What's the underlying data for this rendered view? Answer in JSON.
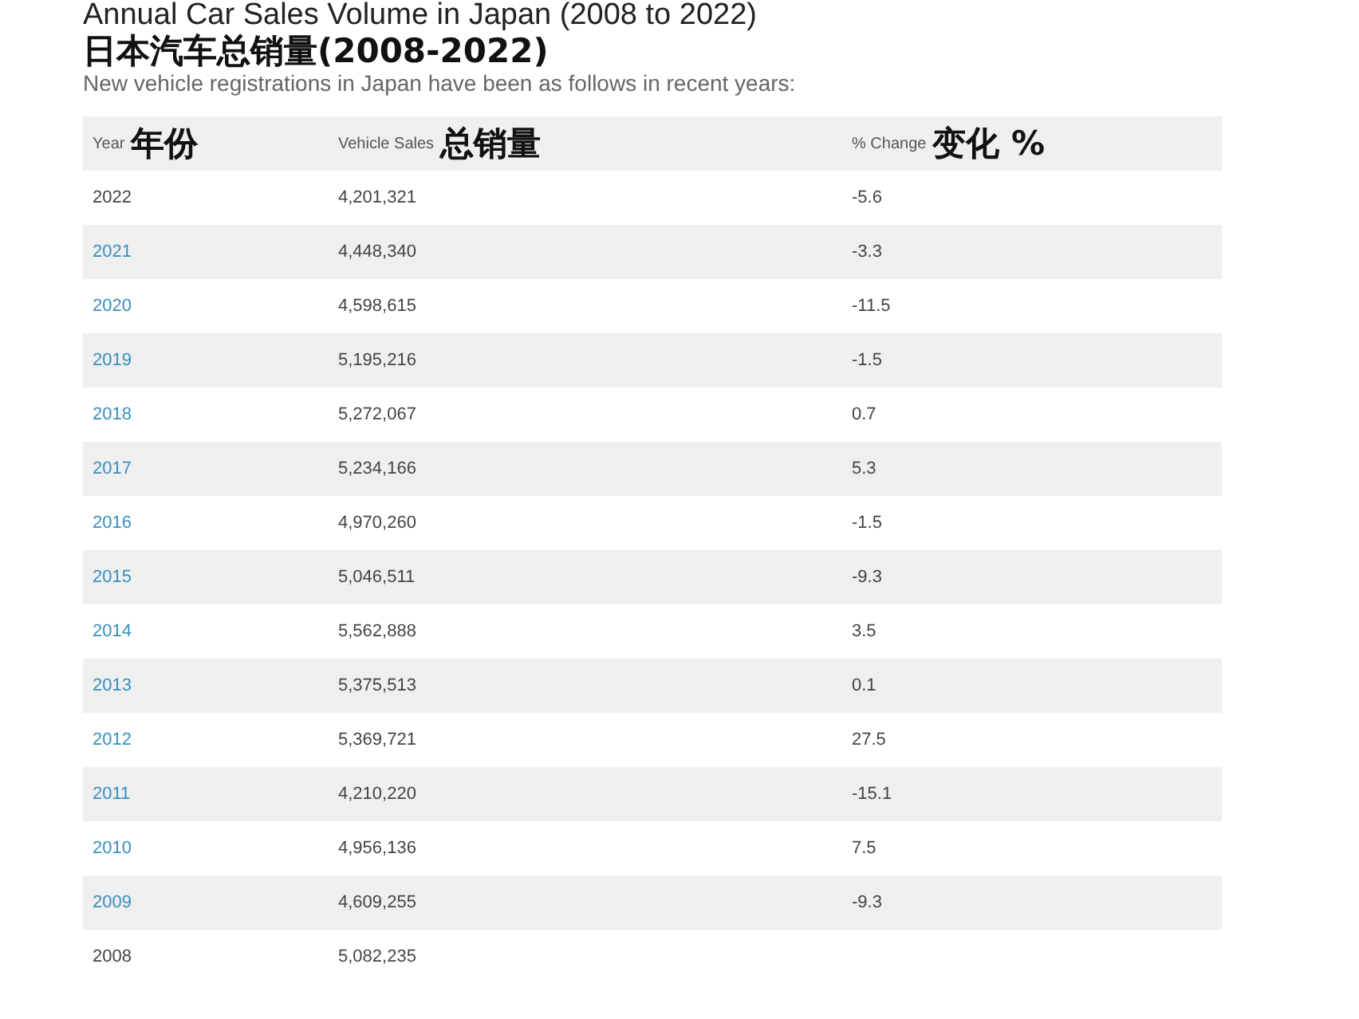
{
  "title": "Annual Car Sales Volume in Japan (2008 to 2022)",
  "title_zh": "日本汽车总销量(2008-2022)",
  "subtitle": "New vehicle registrations in Japan have been as follows in recent years:",
  "table": {
    "columns": [
      {
        "label": "Year",
        "label_zh": "年份"
      },
      {
        "label": "Vehicle Sales",
        "label_zh": "总销量"
      },
      {
        "label": "% Change",
        "label_zh": "变化 %"
      }
    ],
    "rows": [
      {
        "year": "2022",
        "kind": "plain",
        "sales": "4,201,321",
        "change": "-5.6"
      },
      {
        "year": "2021",
        "kind": "link",
        "sales": "4,448,340",
        "change": "-3.3"
      },
      {
        "year": "2020",
        "kind": "link",
        "sales": "4,598,615",
        "change": "-11.5"
      },
      {
        "year": "2019",
        "kind": "link",
        "sales": "5,195,216",
        "change": "-1.5"
      },
      {
        "year": "2018",
        "kind": "link",
        "sales": "5,272,067",
        "change": "0.7"
      },
      {
        "year": "2017",
        "kind": "link",
        "sales": "5,234,166",
        "change": "5.3"
      },
      {
        "year": "2016",
        "kind": "link",
        "sales": "4,970,260",
        "change": "-1.5"
      },
      {
        "year": "2015",
        "kind": "link",
        "sales": "5,046,511",
        "change": "-9.3"
      },
      {
        "year": "2014",
        "kind": "link",
        "sales": "5,562,888",
        "change": "3.5"
      },
      {
        "year": "2013",
        "kind": "link",
        "sales": "5,375,513",
        "change": "0.1"
      },
      {
        "year": "2012",
        "kind": "link",
        "sales": "5,369,721",
        "change": "27.5"
      },
      {
        "year": "2011",
        "kind": "link",
        "sales": "4,210,220",
        "change": "-15.1"
      },
      {
        "year": "2010",
        "kind": "link",
        "sales": "4,956,136",
        "change": "7.5"
      },
      {
        "year": "2009",
        "kind": "link",
        "sales": "4,609,255",
        "change": "-9.3"
      },
      {
        "year": "2008",
        "kind": "plain",
        "sales": "5,082,235"
      }
    ]
  }
}
